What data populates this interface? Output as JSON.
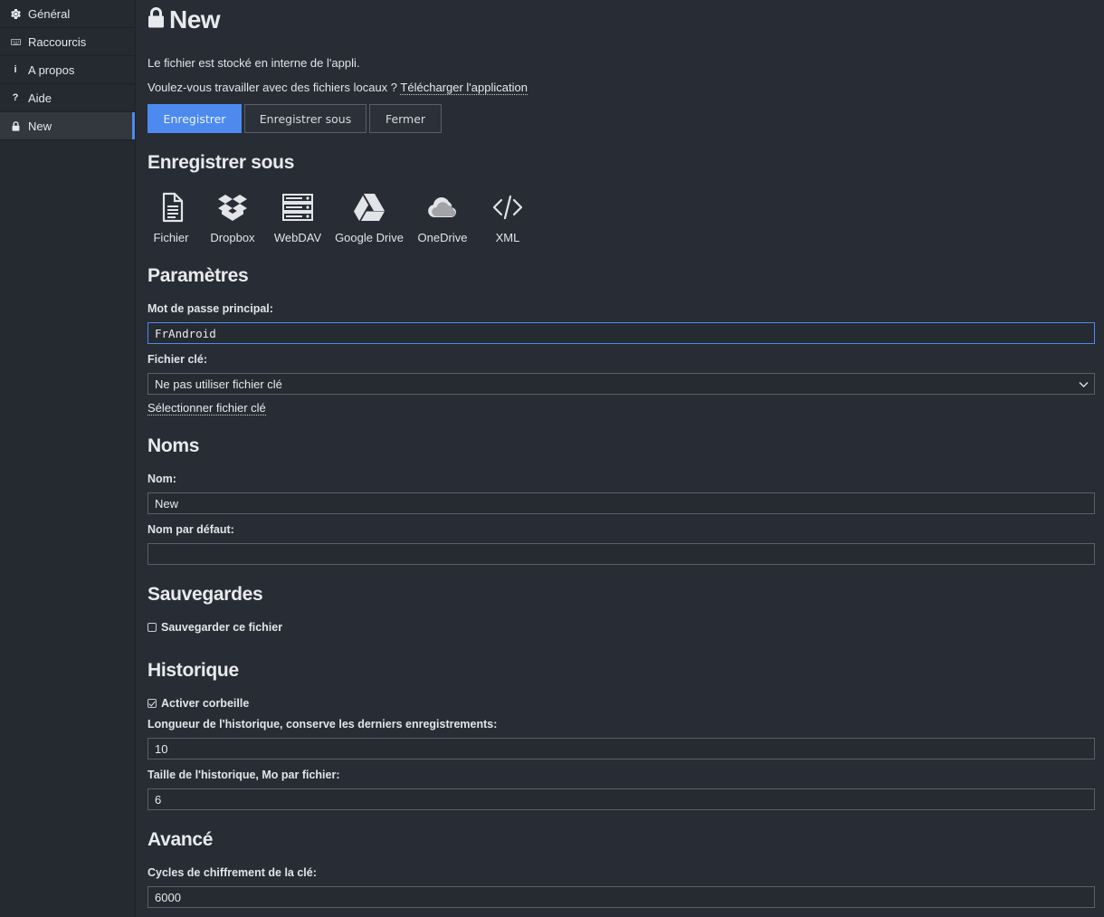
{
  "sidebar": {
    "items": [
      {
        "label": "Général",
        "icon": "gear-icon"
      },
      {
        "label": "Raccourcis",
        "icon": "keyboard-icon"
      },
      {
        "label": "A propos",
        "icon": "info-icon"
      },
      {
        "label": "Aide",
        "icon": "question-icon"
      },
      {
        "label": "New",
        "icon": "lock-icon",
        "active": true
      }
    ]
  },
  "header": {
    "title": "New",
    "info_line": "Le fichier est stocké en interne de l'appli.",
    "local_question": "Voulez-vous travailler avec des fichiers locaux ?",
    "download_link": "Télécharger l'application"
  },
  "actions": {
    "save": "Enregistrer",
    "save_as": "Enregistrer sous",
    "close": "Fermer"
  },
  "save_as_section": {
    "title": "Enregistrer sous",
    "targets": [
      {
        "label": "Fichier",
        "icon": "file-icon"
      },
      {
        "label": "Dropbox",
        "icon": "dropbox-icon"
      },
      {
        "label": "WebDAV",
        "icon": "server-icon"
      },
      {
        "label": "Google Drive",
        "icon": "google-drive-icon"
      },
      {
        "label": "OneDrive",
        "icon": "cloud-icon"
      },
      {
        "label": "XML",
        "icon": "code-icon"
      }
    ]
  },
  "settings": {
    "title": "Paramètres",
    "master_password_label": "Mot de passe principal:",
    "master_password_value": "FrAndroid",
    "key_file_label": "Fichier clé:",
    "key_file_value": "Ne pas utiliser fichier clé",
    "select_key_file": "Sélectionner fichier clé"
  },
  "names": {
    "title": "Noms",
    "name_label": "Nom:",
    "name_value": "New",
    "default_name_label": "Nom par défaut:",
    "default_name_value": ""
  },
  "backups": {
    "title": "Sauvegardes",
    "backup_file_label": "Sauvegarder ce fichier",
    "backup_file_checked": false
  },
  "history": {
    "title": "Historique",
    "trash_label": "Activer corbeille",
    "trash_checked": true,
    "length_label": "Longueur de l'historique, conserve les derniers enregistrements:",
    "length_value": "10",
    "size_label": "Taille de l'historique, Mo par fichier:",
    "size_value": "6"
  },
  "advanced": {
    "title": "Avancé",
    "rounds_label": "Cycles de chiffrement de la clé:",
    "rounds_value": "6000"
  },
  "colors": {
    "background": "#282c34",
    "accent": "#4d8af0",
    "text": "#d8dbe0"
  }
}
